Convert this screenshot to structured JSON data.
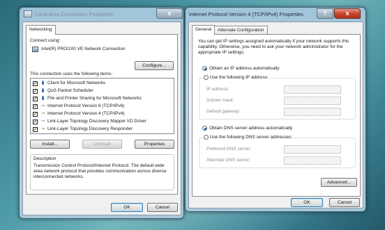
{
  "window_left": {
    "title": "Local Area Connection Properties",
    "close_label": "x",
    "tab": "Networking",
    "connect_using_label": "Connect using:",
    "adapter": "Intel(R) PRO/100 VE Network Connection",
    "configure_button": "Configure...",
    "items_label": "This connection uses the following items:",
    "items": [
      {
        "label": "Client for Microsoft Networks",
        "checked": "✓",
        "icon": "network-client-icon"
      },
      {
        "label": "QoS Packet Scheduler",
        "checked": "✓",
        "icon": "qos-scheduler-icon"
      },
      {
        "label": "File and Printer Sharing for Microsoft Networks",
        "checked": "✓",
        "icon": "file-printer-sharing-icon"
      },
      {
        "label": "Internet Protocol Version 6 (TCP/IPv6)",
        "checked": "✓",
        "icon": "protocol-icon"
      },
      {
        "label": "Internet Protocol Version 4 (TCP/IPv4)",
        "checked": "✓",
        "icon": "protocol-icon"
      },
      {
        "label": "Link-Layer Topology Discovery Mapper I/O Driver",
        "checked": "✓",
        "icon": "protocol-icon"
      },
      {
        "label": "Link-Layer Topology Discovery Responder",
        "checked": "✓",
        "icon": "protocol-icon"
      }
    ],
    "install_button": "Install...",
    "uninstall_button": "Uninstall",
    "properties_button": "Properties",
    "description_title": "Description",
    "description_text": "Transmission Control Protocol/Internet Protocol. The default wide area network protocol that provides communication across diverse interconnected networks.",
    "ok_button": "OK",
    "cancel_button": "Cancel"
  },
  "window_right": {
    "title": "Internet Protocol Version 4 (TCP/IPv4) Properties",
    "help_label": "?",
    "close_label": "x",
    "tabs": [
      "General",
      "Alternate Configuration"
    ],
    "intro_text": "You can get IP settings assigned automatically if your network supports this capability. Otherwise, you need to ask your network administrator for the appropriate IP settings.",
    "radio_ip_auto": "Obtain an IP address automatically",
    "radio_ip_manual": "Use the following IP address:",
    "ip_address_label": "IP address:",
    "subnet_mask_label": "Subnet mask:",
    "default_gateway_label": "Default gateway:",
    "radio_dns_auto": "Obtain DNS server address automatically",
    "radio_dns_manual": "Use the following DNS server addresses:",
    "preferred_dns_label": "Preferred DNS server:",
    "alternate_dns_label": "Alternate DNS server:",
    "ip_dots": ".",
    "advanced_button": "Advanced...",
    "ok_button": "OK",
    "cancel_button": "Cancel"
  }
}
